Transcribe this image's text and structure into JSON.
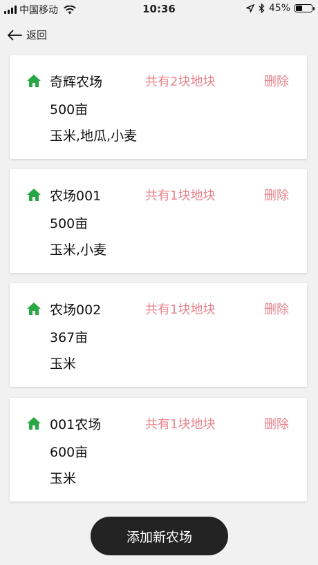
{
  "status_bar": {
    "carrier": "中国移动",
    "time": "10:36",
    "battery": "45%",
    "battery_level": 0.45
  },
  "nav": {
    "back_label": "返回"
  },
  "farms": [
    {
      "name": "奇辉农场",
      "plots": "共有2块地块",
      "delete": "删除",
      "area": "500亩",
      "crops": "玉米,地瓜,小麦"
    },
    {
      "name": "农场001",
      "plots": "共有1块地块",
      "delete": "删除",
      "area": "500亩",
      "crops": "玉米,小麦"
    },
    {
      "name": "农场002",
      "plots": "共有1块地块",
      "delete": "删除",
      "area": "367亩",
      "crops": "玉米"
    },
    {
      "name": "001农场",
      "plots": "共有1块地块",
      "delete": "删除",
      "area": "600亩",
      "crops": "玉米"
    }
  ],
  "add_button": {
    "label": "添加新农场"
  },
  "colors": {
    "home_icon": "#2aa745",
    "accent": "#e8838b",
    "button_bg": "#232323"
  },
  "icons": {
    "back": "arrow-left-icon",
    "farm": "home-icon"
  }
}
